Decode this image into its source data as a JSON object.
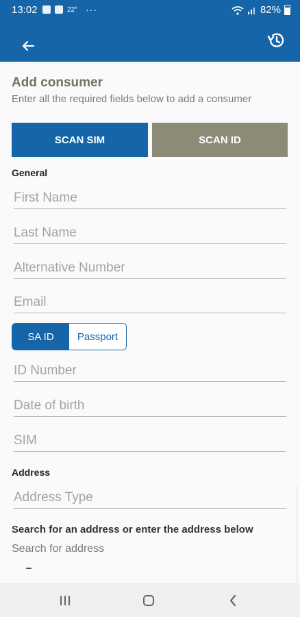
{
  "status_bar": {
    "time": "13:02",
    "temperature": "22°",
    "more": "···",
    "battery": "82%",
    "icons": [
      "notification-icon",
      "mail-icon",
      "wifi-icon",
      "signal-icon",
      "battery-icon"
    ]
  },
  "app_bar": {
    "back_icon": "arrow-left-icon",
    "history_icon": "history-icon"
  },
  "page": {
    "title": "Add consumer",
    "subtitle": "Enter all the required fields below to add a consumer",
    "scan_sim": "SCAN SIM",
    "scan_id": "SCAN ID"
  },
  "general": {
    "heading": "General",
    "fields": {
      "first_name": "First Name",
      "last_name": "Last Name",
      "alternative_number": "Alternative Number",
      "email": "Email",
      "id_number": "ID Number",
      "date_of_birth": "Date of birth",
      "sim": "SIM"
    },
    "id_toggle": {
      "sa_id": "SA ID",
      "passport": "Passport",
      "selected": "SA ID"
    }
  },
  "address": {
    "heading": "Address",
    "address_type": "Address Type",
    "search_heading": "Search for an address or enter the address below",
    "search_link": "Search for address"
  },
  "colors": {
    "primary": "#1565a8",
    "secondary": "#8b8b78",
    "title_text": "#6f7462"
  }
}
